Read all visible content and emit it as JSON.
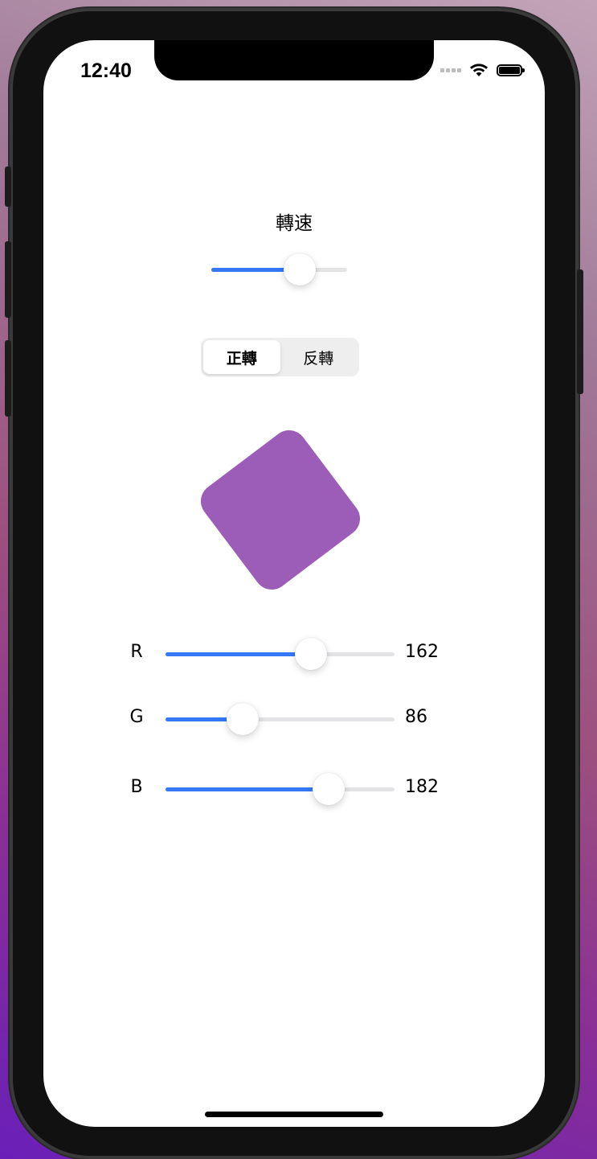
{
  "status_bar": {
    "time": "12:40",
    "icons": [
      "cellular-signal-icon",
      "wifi-icon",
      "battery-icon"
    ]
  },
  "speed": {
    "label": "轉速",
    "value_fraction": 0.65
  },
  "direction": {
    "options": [
      "正轉",
      "反轉"
    ],
    "selected_index": 0
  },
  "preview": {
    "color": "#9b5db8"
  },
  "rgb": [
    {
      "letter": "R",
      "value": "162",
      "fraction": 0.635
    },
    {
      "letter": "G",
      "value": "86",
      "fraction": 0.337
    },
    {
      "letter": "B",
      "value": "182",
      "fraction": 0.714
    }
  ],
  "colors": {
    "accent": "#3478f6",
    "track": "#e4e4e6"
  }
}
